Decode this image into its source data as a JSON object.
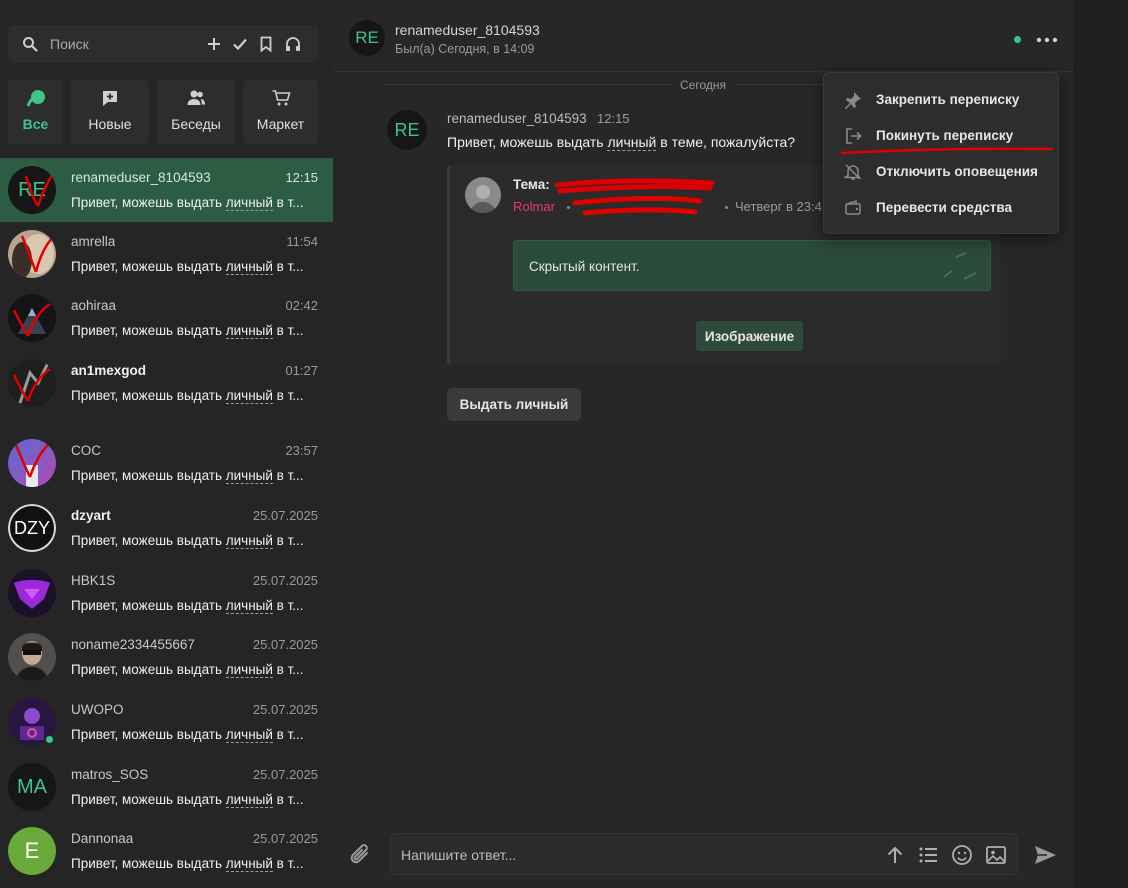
{
  "search": {
    "placeholder": "Поиск"
  },
  "filters": [
    {
      "label": "Все",
      "icon": "leaf-icon",
      "active": true
    },
    {
      "label": "Новые",
      "icon": "chat-plus-icon"
    },
    {
      "label": "Беседы",
      "icon": "users-icon"
    },
    {
      "label": "Маркет",
      "icon": "cart-icon"
    }
  ],
  "chats": [
    {
      "name": "renameduser_8104593",
      "time": "12:15",
      "avatar_text": "RE",
      "msg_pre": "Привет, можешь выдать ",
      "msg_ul": "личный",
      "msg_post": " в т..."
    },
    {
      "name": "amrella",
      "time": "11:54",
      "msg_pre": "Привет, можешь выдать ",
      "msg_ul": "личный",
      "msg_post": " в т..."
    },
    {
      "name": "aohiraa",
      "time": "02:42",
      "msg_pre": "Привет, можешь выдать ",
      "msg_ul": "личный",
      "msg_post": " в т..."
    },
    {
      "name": "an1mexgod",
      "time": "01:27",
      "msg_pre": "Привет, можешь выдать ",
      "msg_ul": "личный",
      "msg_post": " в т..."
    },
    {
      "name": "COC",
      "time": "23:57",
      "msg_pre": "Привет, можешь выдать ",
      "msg_ul": "личный",
      "msg_post": " в т..."
    },
    {
      "name": "dzyart",
      "time": "25.07.2025",
      "avatar_text": "DZY",
      "msg_pre": "Привет, можешь выдать ",
      "msg_ul": "личный",
      "msg_post": " в т..."
    },
    {
      "name": "HBK1S",
      "time": "25.07.2025",
      "msg_pre": "Привет, можешь выдать ",
      "msg_ul": "личный",
      "msg_post": " в т..."
    },
    {
      "name": "noname2334455667",
      "time": "25.07.2025",
      "msg_pre": "Привет, можешь выдать ",
      "msg_ul": "личный",
      "msg_post": " в т..."
    },
    {
      "name": "UWOPO",
      "time": "25.07.2025",
      "msg_pre": "Привет, можешь выдать ",
      "msg_ul": "личный",
      "msg_post": " в т..."
    },
    {
      "name": "matros_SOS",
      "time": "25.07.2025",
      "avatar_text": "MA",
      "msg_pre": "Привет, можешь выдать ",
      "msg_ul": "личный",
      "msg_post": " в т..."
    },
    {
      "name": "Dannonaa",
      "time": "25.07.2025",
      "avatar_text": "E",
      "msg_pre": "Привет, можешь выдать ",
      "msg_ul": "личный",
      "msg_post": " в т..."
    }
  ],
  "header": {
    "avatar_text": "RE",
    "name": "renameduser_8104593",
    "status": "Был(а) Сегодня, в 14:09"
  },
  "day_separator": "Сегодня",
  "message": {
    "avatar_text": "RE",
    "author": "renameduser_8104593",
    "time": "12:15",
    "text_pre": "Привет, можешь выдать ",
    "text_ul": "личный",
    "text_post": " в теме, пожалуйста?",
    "quote": {
      "title": "Тема:",
      "author": "Rolmar",
      "date": "Четверг в 23:4",
      "hidden_content": "Скрытый контент.",
      "image_button": "Изображение"
    },
    "action_button": "Выдать личный"
  },
  "context_menu": [
    {
      "label": "Закрепить переписку",
      "icon": "pin-icon"
    },
    {
      "label": "Покинуть переписку",
      "icon": "leave-icon"
    },
    {
      "label": "Отключить оповещения",
      "icon": "bell-off-icon"
    },
    {
      "label": "Перевести средства",
      "icon": "wallet-icon"
    }
  ],
  "composer": {
    "placeholder": "Напишите ответ..."
  },
  "colors": {
    "accent": "#3cc48b",
    "active_chat": "#2d5c45",
    "author": "#e0397a",
    "annotation": "#e00000"
  }
}
